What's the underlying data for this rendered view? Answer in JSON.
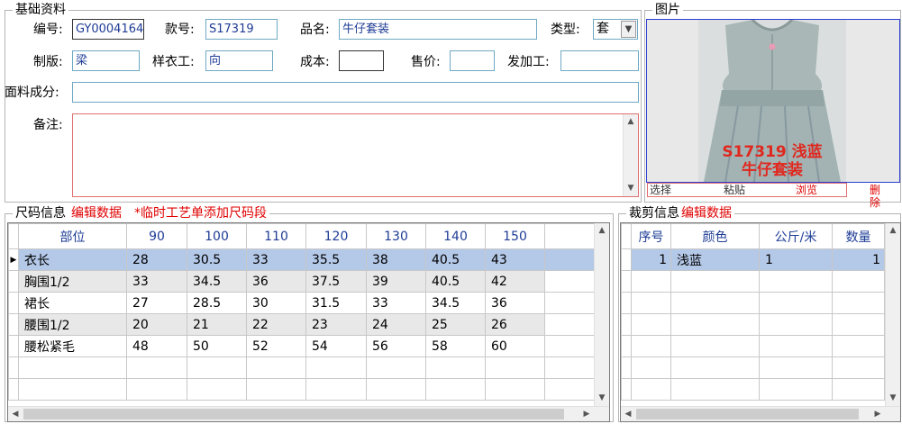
{
  "basic": {
    "legend": "基础资料",
    "fields": {
      "code_label": "编号:",
      "code_value": "GY0004164",
      "style_label": "款号:",
      "style_value": "S17319",
      "name_label": "品名:",
      "name_value": "牛仔套装",
      "type_label": "类型:",
      "type_value": "套",
      "pattern_label": "制版:",
      "pattern_value": "梁",
      "sample_label": "样衣工:",
      "sample_value": "向",
      "cost_label": "成本:",
      "cost_value": "",
      "price_label": "售价:",
      "price_value": "",
      "process_label": "发加工:",
      "process_value": "",
      "fabric_label": "面料成分:",
      "fabric_value": "",
      "remark_label": "备注:",
      "remark_value": ""
    }
  },
  "picture": {
    "legend": "图片",
    "overlay_line1": "S17319 浅蓝",
    "overlay_line2": "牛仔套装",
    "buttons": [
      "选择",
      "粘贴",
      "浏览",
      "删除"
    ]
  },
  "size": {
    "legend": "尺码信息",
    "link1": "编辑数据",
    "link2": "*临时工艺单添加尺码段",
    "headers": [
      "部位",
      "90",
      "100",
      "110",
      "120",
      "130",
      "140",
      "150"
    ],
    "rows": [
      [
        "衣长",
        "28",
        "30.5",
        "33",
        "35.5",
        "38",
        "40.5",
        "43"
      ],
      [
        "胸围1/2",
        "33",
        "34.5",
        "36",
        "37.5",
        "39",
        "40.5",
        "42"
      ],
      [
        "裙长",
        "27",
        "28.5",
        "30",
        "31.5",
        "33",
        "34.5",
        "36"
      ],
      [
        "腰围1/2",
        "20",
        "21",
        "22",
        "23",
        "24",
        "25",
        "26"
      ],
      [
        "腰松紧毛",
        "48",
        "50",
        "52",
        "54",
        "56",
        "58",
        "60"
      ]
    ]
  },
  "cut": {
    "legend": "裁剪信息",
    "link": "编辑数据",
    "headers": [
      "序号",
      "颜色",
      "公斤/米",
      "数量"
    ],
    "rows": [
      [
        "1",
        "浅蓝",
        "1",
        "1"
      ]
    ]
  }
}
